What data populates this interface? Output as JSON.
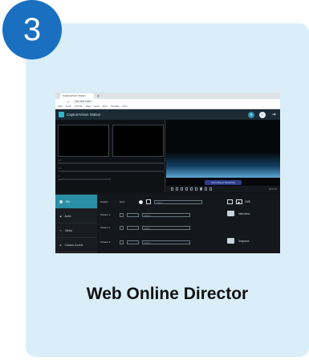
{
  "step": {
    "number": "3"
  },
  "card": {
    "caption": "Web Online Director",
    "bg_color": "#d9eef9",
    "badge_color": "#1a6fc0"
  },
  "screenshot": {
    "tab_title": "CaptureVision Station",
    "url": "192.168.1.100",
    "bookmarks": [
      "Apps",
      "Gmail",
      "YouTube",
      "Maps",
      "News",
      "Drive",
      "Translate",
      "Docs"
    ],
    "app_title": "CaptureVision Station",
    "recording_chip": "Recording & Streaming",
    "timecode": "00:00:00",
    "nav": [
      "Mix",
      "Audio",
      "Media",
      "Camera Control"
    ],
    "streams": {
      "sync_label": "Sync",
      "rows": [
        "Stream",
        "Stream 1",
        "Stream 2",
        "Stream 3"
      ],
      "field_placeholder": "rtmp://..."
    },
    "right": {
      "live_label": "LIVE",
      "interviews_label": "Interviews",
      "snapshot_label": "Snapshot"
    }
  }
}
